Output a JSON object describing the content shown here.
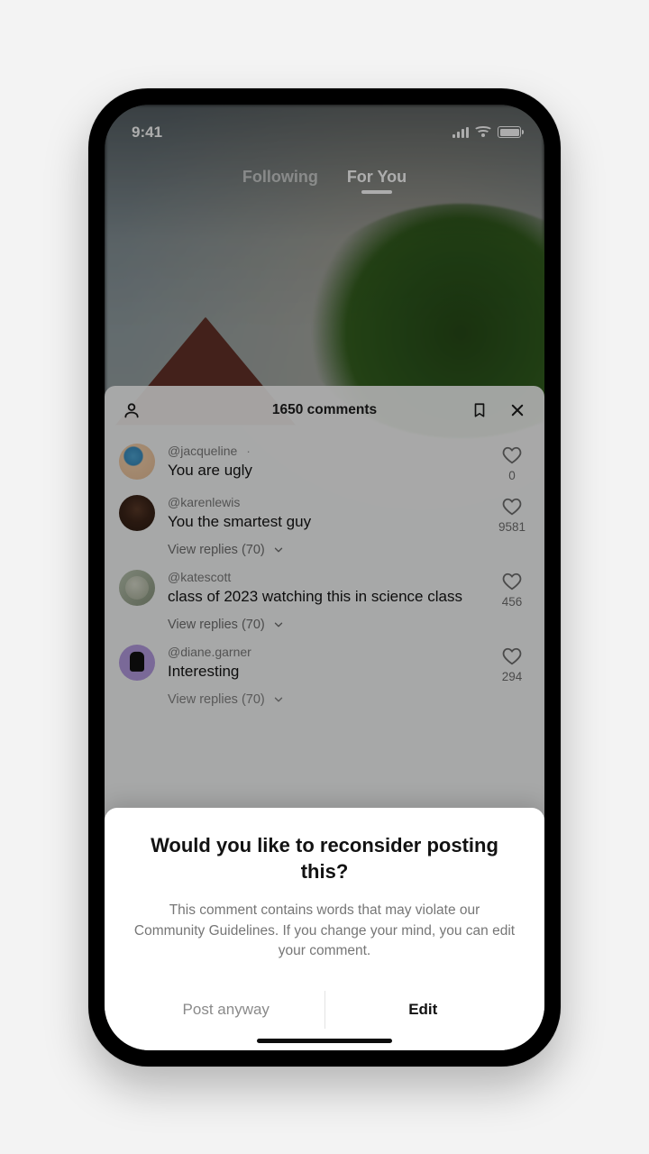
{
  "status": {
    "time": "9:41"
  },
  "feed_tabs": {
    "following": "Following",
    "for_you": "For You"
  },
  "comments_sheet": {
    "count_label": "1650 comments",
    "items": [
      {
        "user": "@jacqueline",
        "text": "You are ugly",
        "likes": "0",
        "show_dot": true
      },
      {
        "user": "@karenlewis",
        "text": "You the smartest guy",
        "likes": "9581",
        "replies": "View replies (70)"
      },
      {
        "user": "@katescott",
        "text": "class of 2023 watching this in science class",
        "likes": "456",
        "replies": "View replies (70)"
      },
      {
        "user": "@diane.garner",
        "text": "Interesting",
        "likes": "294",
        "replies": "View replies (70)"
      }
    ]
  },
  "prompt": {
    "title": "Would you like to reconsider posting this?",
    "body": "This comment contains words that may violate our Community Guidelines. If you change your mind, you can edit your comment.",
    "secondary": "Post anyway",
    "primary": "Edit"
  }
}
